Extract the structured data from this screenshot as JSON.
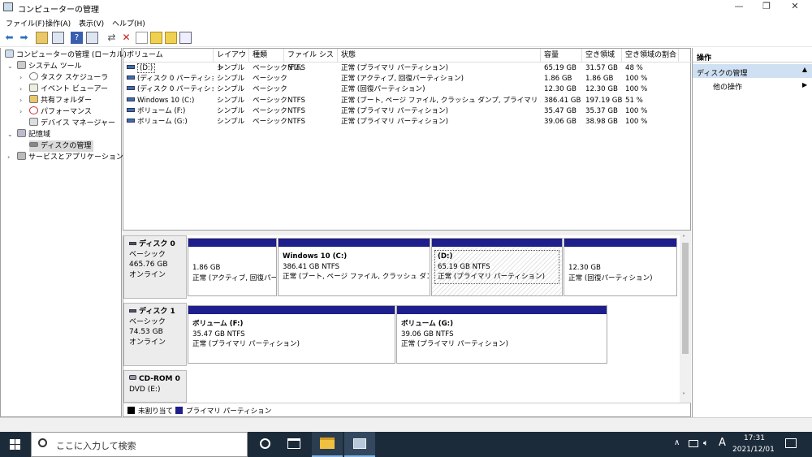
{
  "window": {
    "title": "コンピューターの管理",
    "minimize": "—",
    "restore": "❐",
    "close": "✕"
  },
  "menu": [
    "ファイル(F)",
    "操作(A)",
    "表示(V)",
    "ヘルプ(H)"
  ],
  "tree": {
    "root": "コンピューターの管理 (ローカル)",
    "system_tools": "システム ツール",
    "task_scheduler": "タスク スケジューラ",
    "event_viewer": "イベント ビューアー",
    "shared_folders": "共有フォルダー",
    "performance": "パフォーマンス",
    "device_manager": "デバイス マネージャー",
    "storage": "記憶域",
    "disk_management": "ディスクの管理",
    "services_apps": "サービスとアプリケーション"
  },
  "volume_table": {
    "headers": [
      "ボリューム",
      "レイアウト",
      "種類",
      "ファイル システム",
      "状態",
      "容量",
      "空き領域",
      "空き領域の割合"
    ],
    "rows": [
      [
        "(D:)",
        "シンプル",
        "ベーシック",
        "NTFS",
        "正常 (プライマリ パーティション)",
        "65.19 GB",
        "31.57 GB",
        "48 %"
      ],
      [
        "(ディスク 0 パーティション 1)",
        "シンプル",
        "ベーシック",
        "",
        "正常 (アクティブ, 回復パーティション)",
        "1.86 GB",
        "1.86 GB",
        "100 %"
      ],
      [
        "(ディスク 0 パーティション 4)",
        "シンプル",
        "ベーシック",
        "",
        "正常 (回復パーティション)",
        "12.30 GB",
        "12.30 GB",
        "100 %"
      ],
      [
        "Windows 10 (C:)",
        "シンプル",
        "ベーシック",
        "NTFS",
        "正常 (ブート, ページ ファイル, クラッシュ ダンプ, プライマリ パーティション)",
        "386.41 GB",
        "197.19 GB",
        "51 %"
      ],
      [
        "ボリューム (F:)",
        "シンプル",
        "ベーシック",
        "NTFS",
        "正常 (プライマリ パーティション)",
        "35.47 GB",
        "35.37 GB",
        "100 %"
      ],
      [
        "ボリューム (G:)",
        "シンプル",
        "ベーシック",
        "NTFS",
        "正常 (プライマリ パーティション)",
        "39.06 GB",
        "38.98 GB",
        "100 %"
      ]
    ]
  },
  "disks": [
    {
      "name": "ディスク 0",
      "type": "ベーシック",
      "size": "465.76 GB",
      "status": "オンライン",
      "partitions": [
        {
          "title": "",
          "size": "1.86 GB",
          "status": "正常 (アクティブ, 回復パーテ"
        },
        {
          "title": "Windows 10  (C:)",
          "size": "386.41 GB NTFS",
          "status": "正常 (ブート, ページ ファイル, クラッシュ ダンプ, プライ"
        },
        {
          "title": "(D:)",
          "size": "65.19 GB NTFS",
          "status": "正常 (プライマリ パーティション)"
        },
        {
          "title": "",
          "size": "12.30 GB",
          "status": "正常 (回復パーティション)"
        }
      ]
    },
    {
      "name": "ディスク 1",
      "type": "ベーシック",
      "size": "74.53 GB",
      "status": "オンライン",
      "partitions": [
        {
          "title": "ボリューム  (F:)",
          "size": "35.47 GB NTFS",
          "status": "正常 (プライマリ パーティション)"
        },
        {
          "title": "ボリューム  (G:)",
          "size": "39.06 GB NTFS",
          "status": "正常 (プライマリ パーティション)"
        }
      ]
    },
    {
      "name": "CD-ROM 0",
      "type": "DVD (E:)"
    }
  ],
  "legend": {
    "unallocated": "未割り当て",
    "primary": "プライマリ パーティション"
  },
  "actions": {
    "header": "操作",
    "section": "ディスクの管理",
    "more": "他の操作"
  },
  "taskbar": {
    "search_placeholder": "ここに入力して検索",
    "ime": "A",
    "time": "17:31",
    "date": "2021/12/01"
  },
  "colors": {
    "partition_bar": "#1e1e8c",
    "taskbar": "#1c2b3a",
    "actions_selected": "#cfe0f3"
  }
}
